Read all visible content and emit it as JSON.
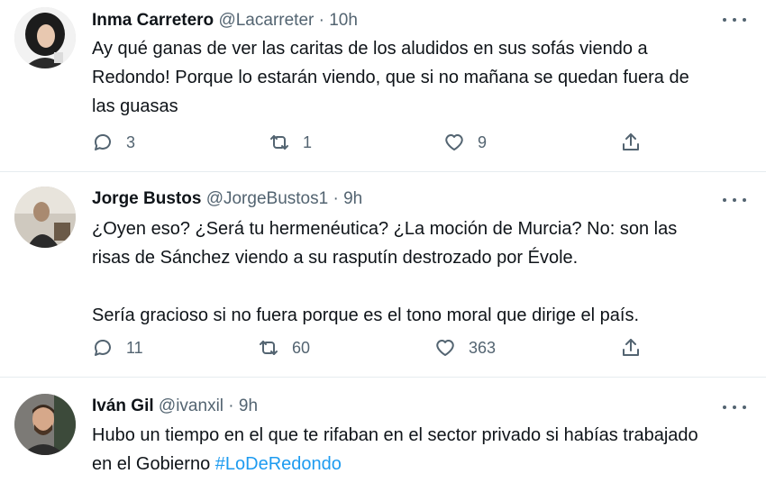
{
  "tweets": [
    {
      "name": "Inma Carretero",
      "handle": "@Lacarreter",
      "separator": "·",
      "time": "10h",
      "text_lines": [
        "Ay qué ganas de ver las caritas de los aludidos en sus sofás viendo a",
        "Redondo! Porque lo estarán viendo, que si no mañana se quedan fuera de",
        "las guasas"
      ],
      "replies": "3",
      "retweets": "1",
      "likes": "9"
    },
    {
      "name": "Jorge Bustos",
      "handle": "@JorgeBustos1",
      "separator": "·",
      "time": "9h",
      "text_lines": [
        "¿Oyen eso? ¿Será tu hermenéutica? ¿La moción de Murcia? No: son las",
        "risas de Sánchez viendo a su rasputín destrozado por Évole.",
        "",
        "Sería gracioso si no fuera porque es el tono moral que dirige el país."
      ],
      "replies": "11",
      "retweets": "60",
      "likes": "363"
    },
    {
      "name": "Iván Gil",
      "handle": "@ivanxil",
      "separator": "·",
      "time": "9h",
      "text_line_1": "Hubo un tiempo en el que te rifaban en el sector privado si habías trabajado",
      "text_line_2_prefix": "en el Gobierno ",
      "hashtag": "#LoDeRedondo"
    }
  ],
  "icons": {
    "reply": "reply-icon",
    "retweet": "retweet-icon",
    "like": "heart-icon",
    "share": "share-icon",
    "more": "more-icon"
  },
  "colors": {
    "text": "#0f1419",
    "secondary": "#536471",
    "link": "#1d9bf0",
    "divider": "#e6ecf0"
  }
}
